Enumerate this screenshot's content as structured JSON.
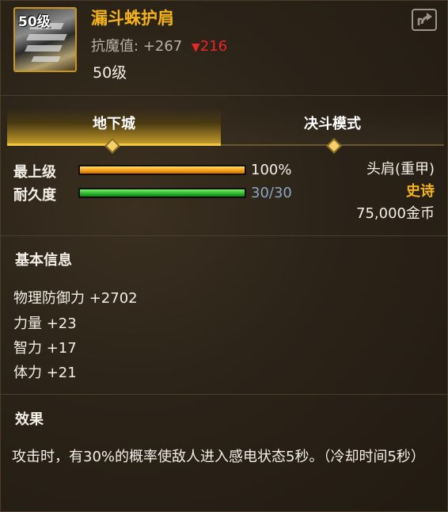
{
  "item": {
    "badge_level": "50级",
    "name": "漏斗蛛护肩",
    "stat_label": "抗魔值:",
    "stat_value": "+267",
    "stat_drop_arrow": "▼",
    "stat_drop": "216",
    "level": "50级",
    "icon": "shoulder-armor-icon"
  },
  "share_icon": "share-icon",
  "tabs": [
    {
      "label": "地下城",
      "active": true
    },
    {
      "label": "决斗模式",
      "active": false
    }
  ],
  "bars": [
    {
      "label": "最上级",
      "value_text": "100%",
      "fraction": 1.0,
      "color": "#f59a14"
    },
    {
      "label": "耐久度",
      "value_text": "30/30",
      "fraction": 1.0,
      "color": "#2bb62a"
    }
  ],
  "info": {
    "slot": "头肩(重甲)",
    "rarity": "史诗",
    "rarity_color": "#f4b318",
    "price": "75,000金币"
  },
  "basic": {
    "title": "基本信息",
    "attributes": [
      "物理防御力 +2702",
      "力量 +23",
      "智力 +17",
      "体力 +21"
    ]
  },
  "effect": {
    "title": "效果",
    "text": "攻击时，有30%的概率使敌人进入感电状态5秒。（冷却时间5秒）"
  }
}
